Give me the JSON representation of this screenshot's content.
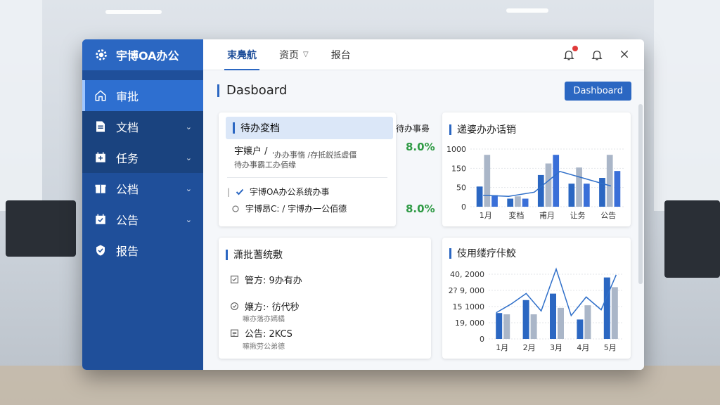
{
  "app": {
    "name": "宇博OA办公"
  },
  "sidebar": {
    "items": [
      {
        "label": "审批",
        "icon": "home-icon",
        "state": "active"
      },
      {
        "label": "文档",
        "icon": "document-icon",
        "expandable": true
      },
      {
        "label": "任务",
        "icon": "calendar-icon",
        "expandable": true
      },
      {
        "label": "公档",
        "icon": "gift-icon",
        "expandable": true
      },
      {
        "label": "公告",
        "icon": "calendar-check-icon",
        "expandable": true
      },
      {
        "label": "报告",
        "icon": "shield-check-icon"
      }
    ]
  },
  "topbar": {
    "tabs": [
      {
        "label": "束鳧航",
        "active": true
      },
      {
        "label": "资页",
        "dropdown": true
      },
      {
        "label": "报台"
      }
    ],
    "icons": [
      "bell-alert-icon",
      "bell-icon",
      "close-icon"
    ]
  },
  "page": {
    "title": "Dasboard",
    "action_button": "Dashboard"
  },
  "todo_card": {
    "title": "待办変档",
    "line1": "宇嬢户 /",
    "line1_detail": "'办办事惰 /存抵鋭抵虚僵",
    "line2": "待办事霸工办佰缘",
    "item1": "宇博OA办公系统办事",
    "item2": "宇博昂C: / 宇博办一公佰德",
    "stat_label": "待办事臱",
    "stat1": "8.0%",
    "stat2": "8.0%"
  },
  "chart_top": {
    "title": "递婆办办话销"
  },
  "approval_card": {
    "title": "潇批蓍统敷",
    "rows": [
      {
        "icon": "checklist-icon",
        "text": "管方: 9办有办",
        "sub": ""
      },
      {
        "icon": "check-circle-icon",
        "text": "嬢方:· 彷代秒",
        "sub": "嘛亦落亦嫣橘"
      },
      {
        "icon": "calendar-list-icon",
        "text": "公告: 2KCS",
        "sub": "嘛揪劳公弟德"
      }
    ]
  },
  "chart_bottom": {
    "title": "伎用缕疗佧鮫"
  },
  "chart_data": [
    {
      "type": "bar",
      "title": "递婆办办话销",
      "categories": [
        "1月",
        "変档",
        "甫月",
        "让务",
        "公告"
      ],
      "yticks": [
        "1000",
        "150",
        "50",
        "0"
      ],
      "ylim": [
        0,
        100
      ],
      "series": [
        {
          "values": [
            35,
            14,
            55,
            40,
            50
          ],
          "color": "#2b67c2"
        },
        {
          "values": [
            90,
            18,
            75,
            68,
            90
          ],
          "color": "#aab6c8"
        },
        {
          "values": [
            20,
            14,
            90,
            40,
            62
          ],
          "color": "#3a6fd8"
        }
      ],
      "line": [
        22,
        20,
        28,
        68,
        54,
        40
      ]
    },
    {
      "type": "bar",
      "title": "伎用缕疗佧鮫",
      "categories": [
        "1月",
        "2月",
        "3月",
        "4月",
        "5月"
      ],
      "yticks": [
        "40, 2000",
        "2? 9, 000",
        "15 1000",
        "19, 000",
        "0"
      ],
      "ylim": [
        0,
        100
      ],
      "series": [
        {
          "values": [
            40,
            60,
            70,
            30,
            95
          ],
          "color": "#2b67c2"
        },
        {
          "values": [
            38,
            38,
            48,
            52,
            80
          ],
          "color": "#aab6c8"
        }
      ],
      "line": [
        45,
        60,
        78,
        48,
        120,
        40,
        72,
        50,
        110
      ]
    }
  ]
}
